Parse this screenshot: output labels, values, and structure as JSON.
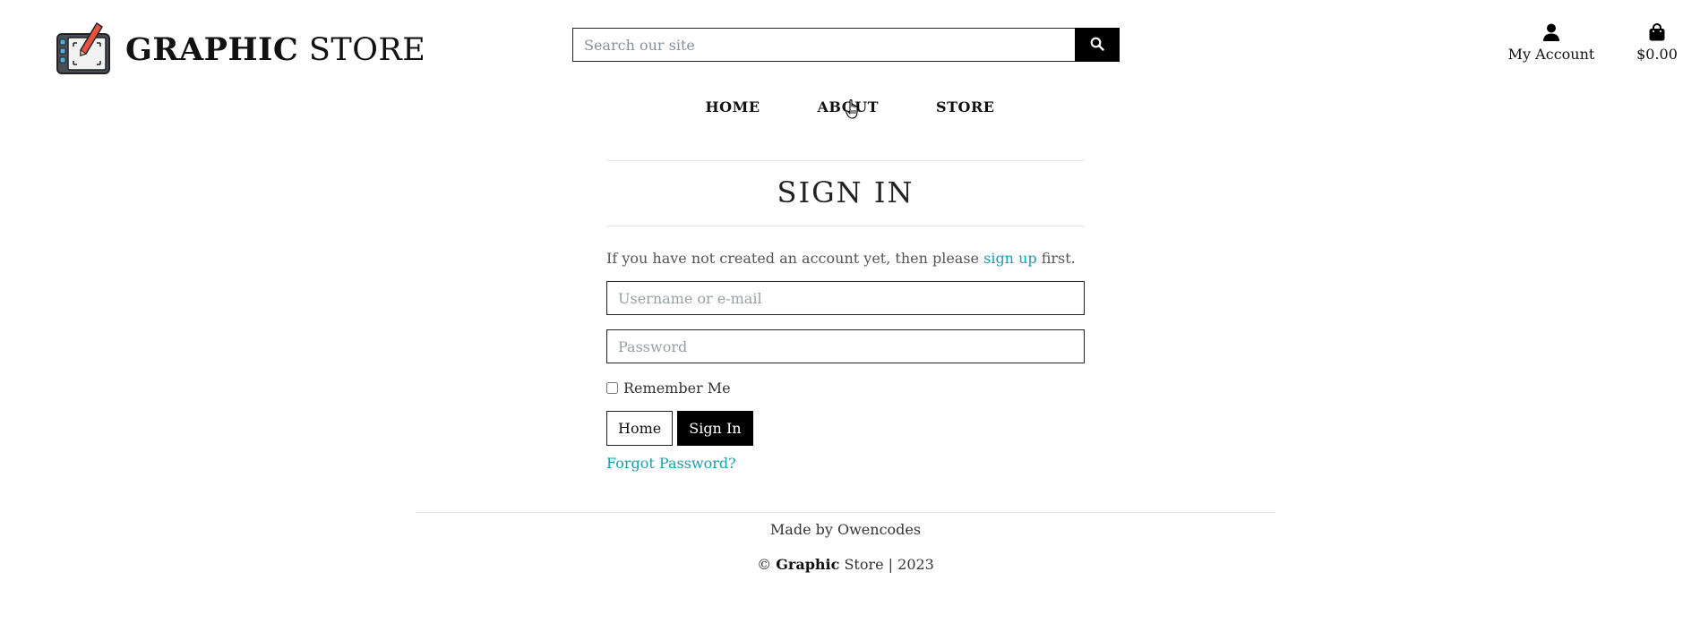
{
  "header": {
    "logo_bold": "GRAPHIC",
    "logo_rest": "STORE",
    "search_placeholder": "Search our site",
    "account_label": "My Account",
    "cart_total": "$0.00"
  },
  "nav": {
    "items": [
      "HOME",
      "ABOUT",
      "STORE"
    ]
  },
  "signin": {
    "title": "SIGN IN",
    "intro_before": "If you have not created an account yet, then please ",
    "intro_link": "sign up",
    "intro_after": " first.",
    "username_placeholder": "Username or e-mail",
    "password_placeholder": "Password",
    "remember_label": "Remember Me",
    "home_button": "Home",
    "signin_button": "Sign In",
    "forgot_link": "Forgot Password?"
  },
  "footer": {
    "made_by": "Made by Owencodes",
    "copy_symbol": "©",
    "copy_bold": "Graphic",
    "copy_rest": "Store | 2023"
  },
  "icons": {
    "search": "search-icon",
    "account": "user-icon",
    "cart": "shopping-bag-icon",
    "logo": "drawing-tablet-icon",
    "cursor": "hand-pointer-icon"
  },
  "colors": {
    "link": "#1a9db1",
    "button_dark": "#000000",
    "rule": "#e4e4e4"
  }
}
